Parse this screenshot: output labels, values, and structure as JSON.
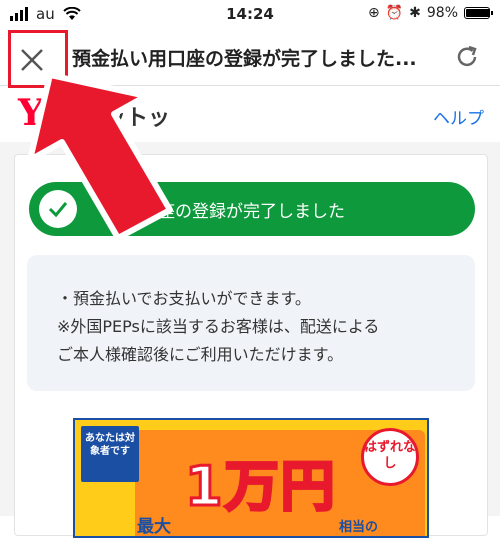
{
  "status_bar": {
    "carrier": "au",
    "time": "14:24",
    "battery": "98%",
    "battery_level": 0.98
  },
  "nav": {
    "title": "預金払い用口座の登録が完了しました...",
    "close_icon": "close-icon",
    "reload_icon": "reload-icon"
  },
  "app": {
    "logo_mark": "Y",
    "logo_text": "ットッ",
    "help_label": "ヘルプ"
  },
  "success": {
    "message": "い用口座の登録が完了しました",
    "icon": "check-icon",
    "color": "#0e9a3c"
  },
  "info": {
    "lines": [
      "・預金払いでお支払いができます。",
      "※外国PEPsに該当するお客様は、配送による",
      "ご本人様確認後にご利用いただけます。"
    ]
  },
  "banner": {
    "badge": "あなたは対象者です",
    "amount": "1万円",
    "prefix": "最大",
    "suffix": "相当の",
    "stamp": "はずれなし"
  },
  "annotation": {
    "color": "#e8192c"
  }
}
